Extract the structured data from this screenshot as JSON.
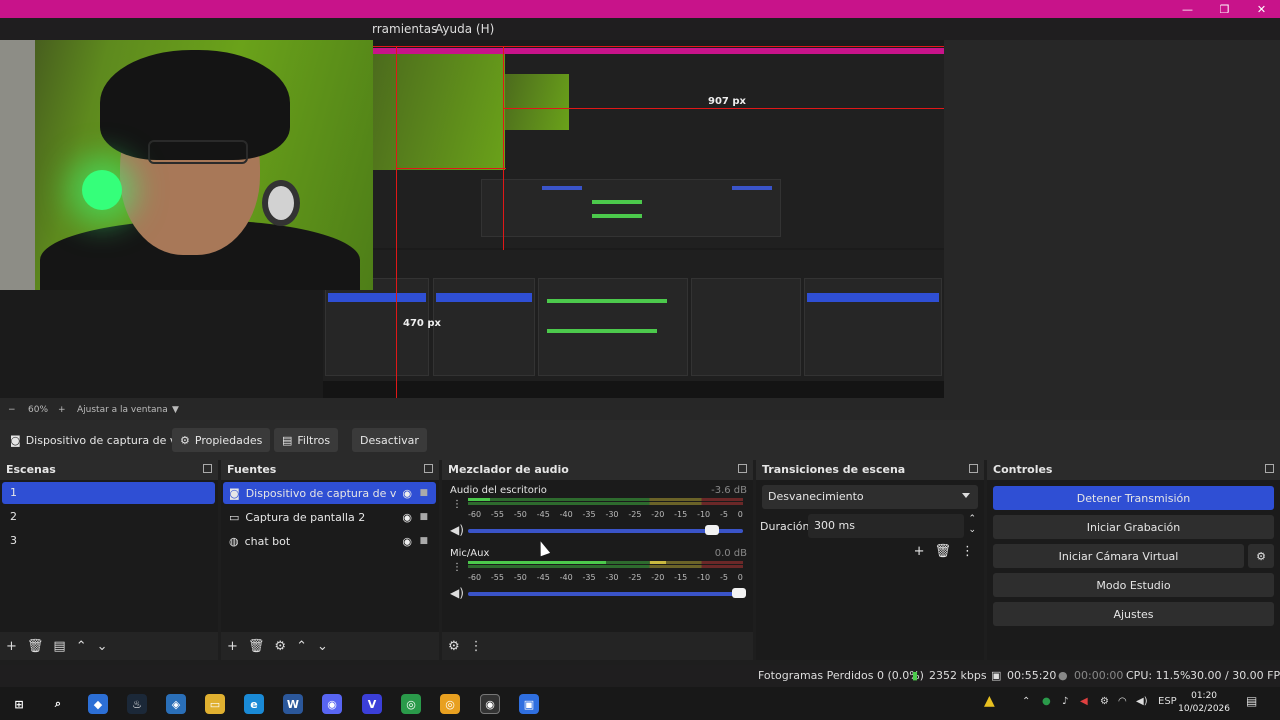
{
  "window": {
    "menu_items": [
      "rramientas",
      "Ayuda (H)"
    ],
    "controls": [
      "—",
      "❐",
      "✕"
    ]
  },
  "preview": {
    "label_907": "907 px",
    "label_470": "470 px"
  },
  "zoom_bar": {
    "minus": "−",
    "zoom": "60%",
    "plus": "+",
    "fit": "Ajustar a la ventana"
  },
  "source_toolbar": {
    "source_name": "Dispositivo de captura de v",
    "properties": "Propiedades",
    "filters": "Filtros",
    "deactivate": "Desactivar"
  },
  "scenes": {
    "title": "Escenas",
    "items": [
      "1",
      "2",
      "3"
    ],
    "selected": "1"
  },
  "sources": {
    "title": "Fuentes",
    "items": [
      {
        "name": "Dispositivo de captura de vide",
        "icon": "camera-icon"
      },
      {
        "name": "Captura de pantalla 2",
        "icon": "monitor-icon"
      },
      {
        "name": "chat bot",
        "icon": "globe-icon"
      }
    ]
  },
  "mixer": {
    "title": "Mezclador de audio",
    "channels": [
      {
        "name": "Audio del escritorio",
        "db": "-3.6 dB",
        "level": 0.35,
        "volume": 0.88
      },
      {
        "name": "Mic/Aux",
        "db": "0.0 dB",
        "level": 0.5,
        "volume": 1.0
      }
    ],
    "ticks": [
      "-60",
      "-55",
      "-50",
      "-45",
      "-40",
      "-35",
      "-30",
      "-25",
      "-20",
      "-15",
      "-10",
      "-5",
      "0"
    ]
  },
  "transitions": {
    "title": "Transiciones de escena",
    "selected": "Desvanecimiento",
    "duration_label": "Duración",
    "duration_value": "300 ms"
  },
  "controls": {
    "title": "Controles",
    "stop_stream": "Detener Transmisión",
    "start_recording": "Iniciar Grabación",
    "start_virtual_cam": "Iniciar Cámara Virtual",
    "studio_mode": "Modo Estudio",
    "settings": "Ajustes"
  },
  "status": {
    "dropped_frames": "Fotogramas Perdidos 0 (0.0%)",
    "bitrate": "2352 kbps",
    "stream_time": "00:55:20",
    "rec_time": "00:00:00",
    "cpu": "CPU: 11.5%",
    "fps": "30.00 / 30.00 FPS"
  },
  "taskbar": {
    "lang": "ESP",
    "time": "01:20",
    "date": "10/02/2026"
  },
  "colors": {
    "accent": "#2f4fd4",
    "title_bar": "#c8138a",
    "guide_lines": "#e01818",
    "meter_green": "#4cc94c",
    "meter_yellow": "#c9b840",
    "meter_red": "#c94040"
  }
}
